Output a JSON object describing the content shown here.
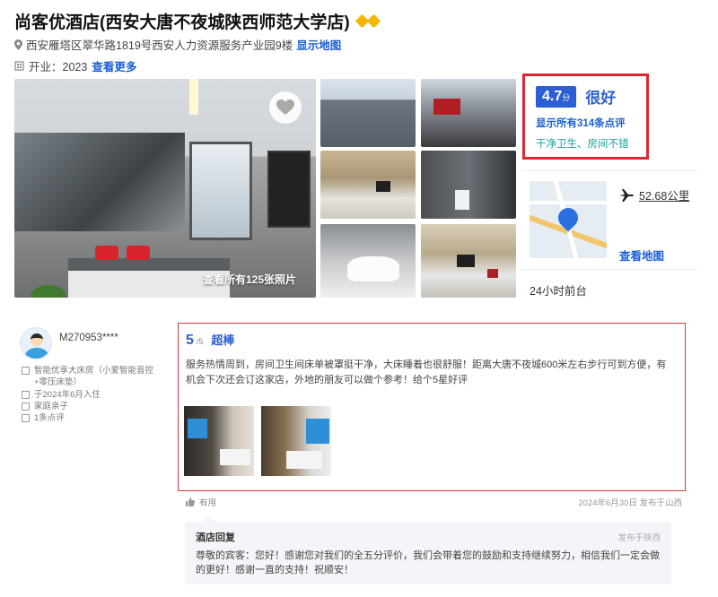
{
  "hotel": {
    "name": "尚客优酒店(西安大唐不夜城陕西师范大学店)",
    "address": "西安雁塔区翠华路1819号西安人力资源服务产业园9楼",
    "show_map": "显示地图",
    "opening": "开业：2023",
    "see_more": "查看更多"
  },
  "gallery": {
    "caption": "查看所有125张照片"
  },
  "rating": {
    "score": "4.7",
    "score_unit": "分",
    "word": "很好",
    "review_link": "显示所有314条点评",
    "tags": "干净卫生、房间不错"
  },
  "location": {
    "distance": "52.68公里",
    "map_link": "查看地图",
    "front_desk": "24小时前台"
  },
  "review": {
    "user": "M270953****",
    "room": "智能优享大床房（小爱智能音控+零压床垫）",
    "stay": "于2024年6月入住",
    "trip_type": "家庭亲子",
    "count": "1条点评",
    "score": "5",
    "score_max": "/5",
    "word": "超棒",
    "text": "服务热情周到，房间卫生间床单被罩挺干净，大床睡着也很舒服！距离大唐不夜城600米左右步行可到方便，有机会下次还会订这家店，外地的朋友可以做个参考！给个5星好评",
    "useful": "有用",
    "posted": "2024年6月30日 发布于山西"
  },
  "reply": {
    "title": "酒店回复",
    "location": "发布于陕西",
    "text": "尊敬的宾客：您好！感谢您对我们的全五分评价，我们会带着您的鼓励和支持继续努力，相信我们一定会做的更好！感谢一直的支持！祝顺安！"
  },
  "colors": {
    "accent_blue": "#2c5fd1",
    "highlight_red": "#e0262d",
    "tag_green": "#16a39b"
  }
}
